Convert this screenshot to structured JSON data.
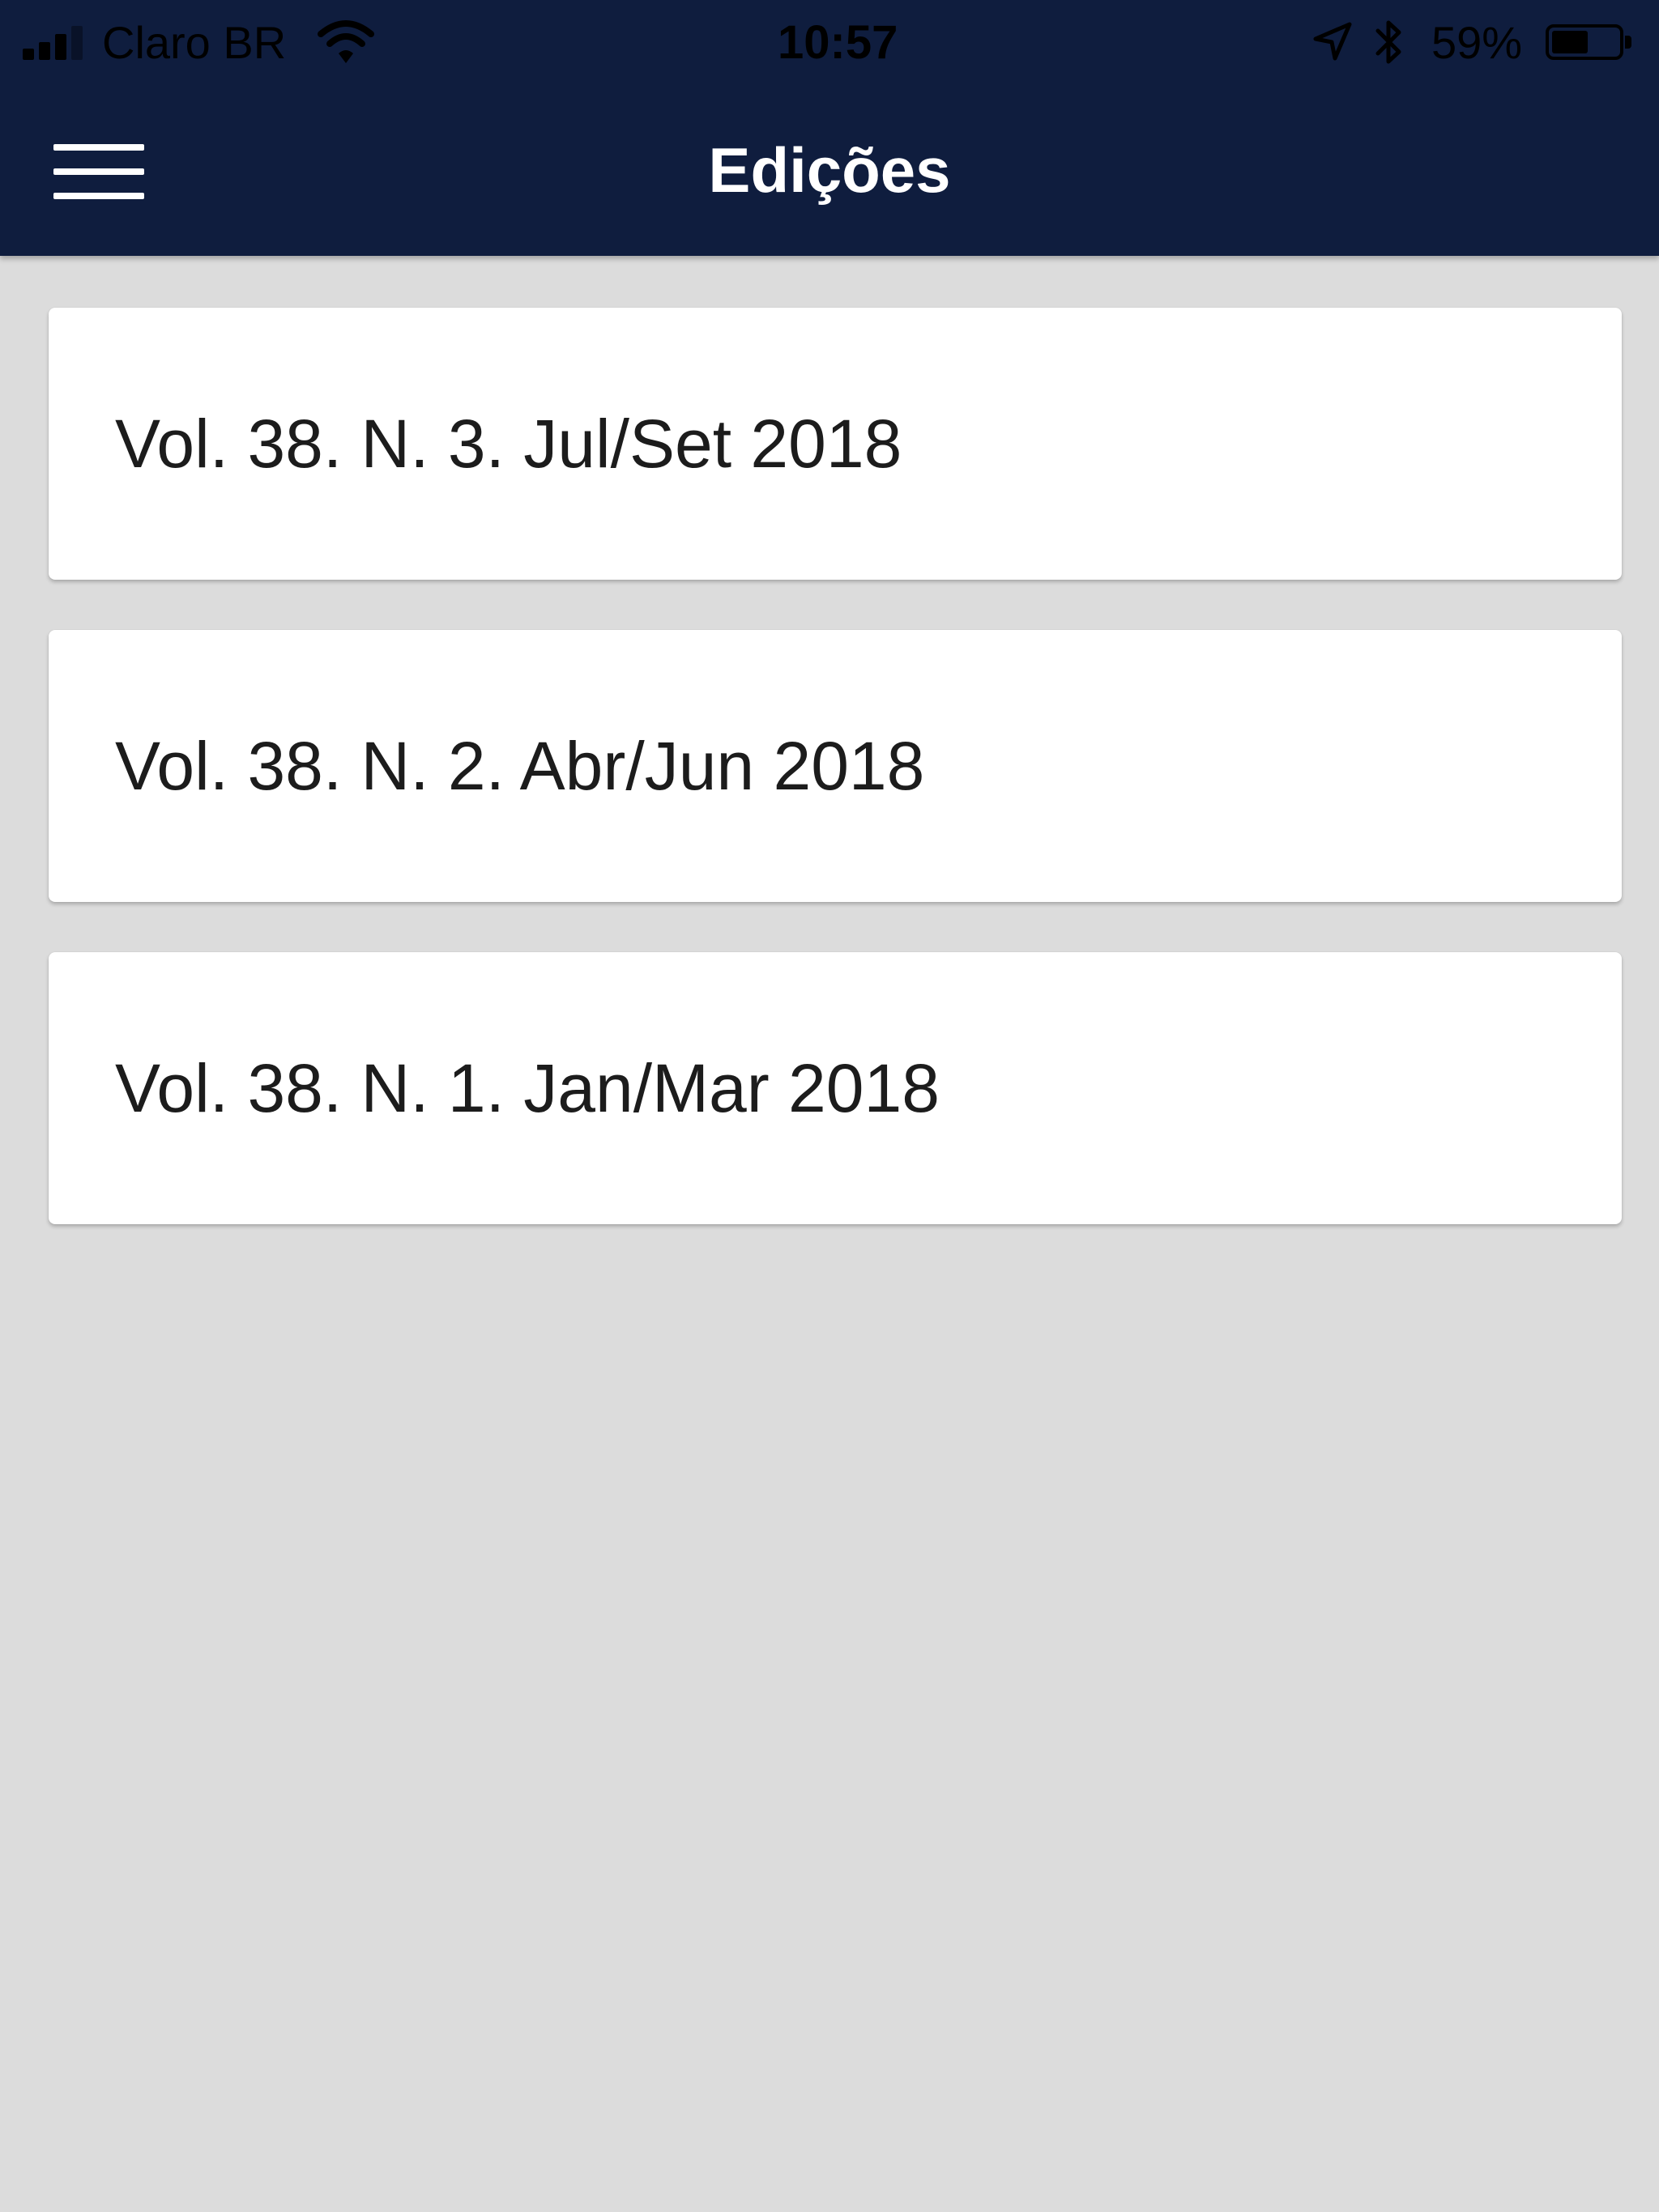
{
  "status_bar": {
    "carrier": "Claro BR",
    "time": "10:57",
    "battery_percent_text": "59%",
    "battery_level": 0.59,
    "icons": [
      "signal-icon",
      "wifi-icon",
      "location-arrow-icon",
      "bluetooth-icon",
      "battery-icon"
    ]
  },
  "header": {
    "title": "Edições",
    "menu_icon": "hamburger-menu-icon",
    "background_color": "#0f1d3e",
    "title_color": "#ffffff"
  },
  "editions": [
    {
      "label": "Vol. 38. N. 3. Jul/Set 2018"
    },
    {
      "label": "Vol. 38. N. 2. Abr/Jun 2018"
    },
    {
      "label": "Vol. 38. N. 1. Jan/Mar 2018"
    }
  ],
  "colors": {
    "page_background": "#dcdcdc",
    "card_background": "#ffffff",
    "card_text": "#1c1c1c"
  }
}
